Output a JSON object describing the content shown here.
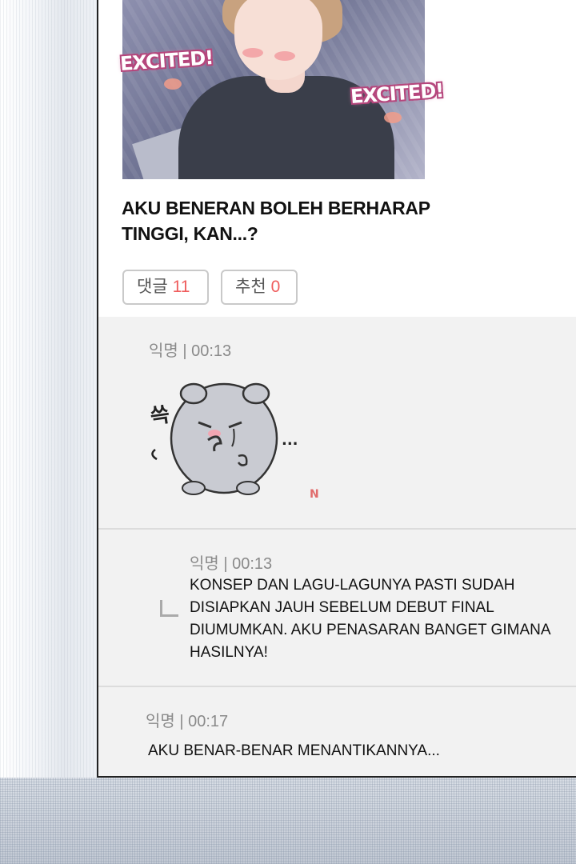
{
  "post": {
    "image": {
      "sfx_left": "EXCITED!",
      "sfx_right": "EXCITED!"
    },
    "title_line1": "AKU BENERAN BOLEH BERHARAP",
    "title_line2": "TINGGI, KAN...?",
    "comments_label": "댓글",
    "comments_count": "11",
    "recommend_label": "추천",
    "recommend_count": "0"
  },
  "comments": [
    {
      "meta": "익명 | 00:13",
      "type": "sticker",
      "sticker": {
        "glyph_left": "쓱",
        "glyph_right": "...",
        "mark": "N",
        "icon": "crying-hamster-sticker"
      }
    },
    {
      "meta": "익명 | 00:13",
      "type": "reply",
      "lines": [
        "KONSEP DAN LAGU-LAGUNYA PASTI SUDAH",
        "DISIAPKAN JAUH SEBELUM DEBUT FINAL",
        "DIUMUMKAN. AKU PENASARAN BANGET GIMANA",
        "HASILNYA!"
      ]
    },
    {
      "meta": "익명 | 00:17",
      "type": "text",
      "lines": [
        "AKU BENAR-BENAR MENANTIKANNYA..."
      ]
    }
  ],
  "colors": {
    "count_accent": "#ef5d5d",
    "sfx_outline": "#b5467c",
    "comments_bg": "#f2f2f2"
  }
}
